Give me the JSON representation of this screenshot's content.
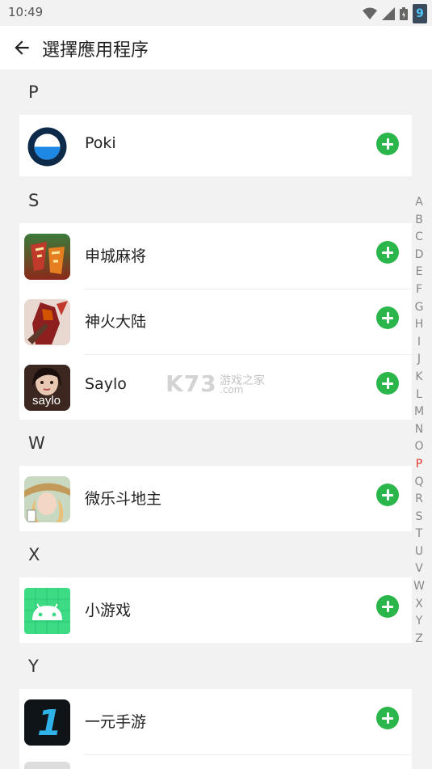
{
  "status_bar": {
    "time": "10:49",
    "badge": "9"
  },
  "header": {
    "title": "選擇應用程序"
  },
  "sections": [
    {
      "letter": "P",
      "apps": [
        {
          "name": "Poki",
          "icon": "poki-icon"
        }
      ]
    },
    {
      "letter": "S",
      "apps": [
        {
          "name": "申城麻将",
          "icon": "mahjong-icon"
        },
        {
          "name": "神火大陆",
          "icon": "warrior-game-icon"
        },
        {
          "name": "Saylo",
          "icon": "saylo-icon",
          "icon_text": "saylo"
        }
      ]
    },
    {
      "letter": "W",
      "apps": [
        {
          "name": "微乐斗地主",
          "icon": "card-game-icon"
        }
      ]
    },
    {
      "letter": "X",
      "apps": [
        {
          "name": "小游戏",
          "icon": "android-icon"
        }
      ]
    },
    {
      "letter": "Y",
      "apps": [
        {
          "name": "一元手游",
          "icon": "yiyuan-icon",
          "icon_text": "1"
        }
      ]
    }
  ],
  "index": [
    "A",
    "B",
    "C",
    "D",
    "E",
    "F",
    "G",
    "H",
    "I",
    "J",
    "K",
    "L",
    "M",
    "N",
    "O",
    "P",
    "Q",
    "R",
    "S",
    "T",
    "U",
    "V",
    "W",
    "X",
    "Y",
    "Z"
  ],
  "active_index": "P",
  "watermark": {
    "main": "K73",
    "sub": "游戏之家",
    "domain": ".com"
  },
  "colors": {
    "accent_add": "#2ab64a",
    "active_index": "#e53935",
    "background": "#f2f2f2"
  }
}
